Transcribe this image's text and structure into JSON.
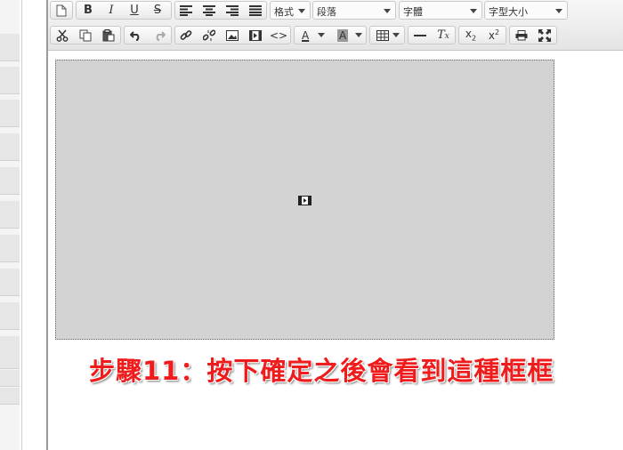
{
  "toolbar": {
    "format_label": "格式",
    "paragraph_label": "段落",
    "font_label": "字體",
    "size_label": "字型大小"
  },
  "icons": [
    "new-document-icon",
    "bold-icon",
    "italic-icon",
    "underline-icon",
    "strikethrough-icon",
    "align-left-icon",
    "align-center-icon",
    "align-right-icon",
    "justify-icon",
    "cut-icon",
    "copy-icon",
    "paste-icon",
    "undo-icon",
    "redo-icon",
    "link-icon",
    "unlink-icon",
    "image-icon",
    "flash-icon",
    "source-icon",
    "text-color-icon",
    "background-color-icon",
    "table-icon",
    "horizontal-rule-icon",
    "remove-format-icon",
    "subscript-icon",
    "superscript-icon",
    "print-icon",
    "maximize-icon",
    "embedded-media-icon"
  ],
  "caption": "步驟11：按下確定之後會看到這種框框"
}
